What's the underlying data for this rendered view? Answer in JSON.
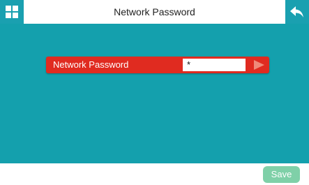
{
  "header": {
    "title": "Network Password",
    "home_icon": "grid-icon",
    "back_icon": "back-arrow-icon"
  },
  "form": {
    "label": "Network Password",
    "value": "*",
    "arrow_icon": "triangle-right-icon"
  },
  "footer": {
    "save_label": "Save"
  },
  "colors": {
    "header_button": "#1aa0b0",
    "main_background": "#14a0ad",
    "row_background": "#e02b20",
    "save_button": "#7fd0a8"
  }
}
